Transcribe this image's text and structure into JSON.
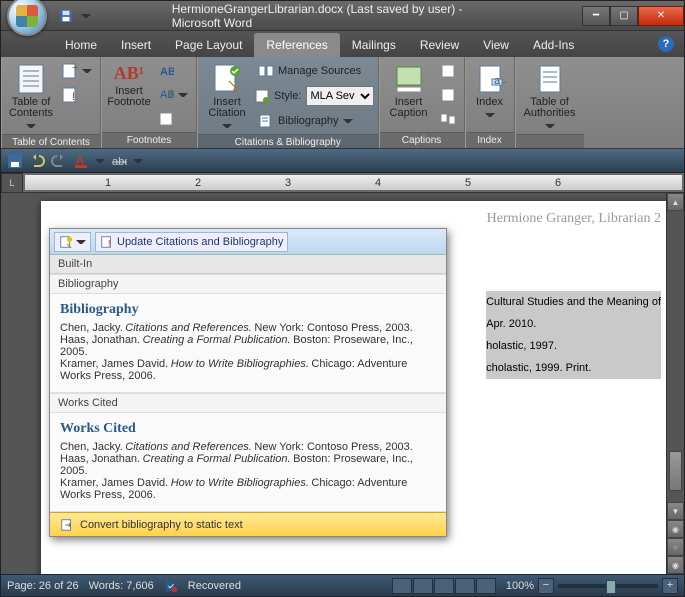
{
  "title": "HermioneGrangerLibrarian.docx (Last saved by user) - Microsoft Word",
  "tabs": [
    "Home",
    "Insert",
    "Page Layout",
    "References",
    "Mailings",
    "Review",
    "View",
    "Add-Ins"
  ],
  "activeTab": "References",
  "ribbon": {
    "toc": {
      "btn": "Table of\nContents",
      "label": "Table of Contents"
    },
    "footnotes": {
      "btn": "Insert\nFootnote",
      "ab": "AB¹",
      "label": "Footnotes"
    },
    "citations": {
      "btn": "Insert\nCitation",
      "manage": "Manage Sources",
      "styleLabel": "Style:",
      "styleVal": "MLA Sev",
      "bib": "Bibliography",
      "label": "Citations & Bibliography"
    },
    "captions": {
      "btn": "Insert\nCaption",
      "label": "Captions"
    },
    "index": {
      "btn": "Index",
      "label": "Index"
    },
    "toa": {
      "btn": "Table of\nAuthorities",
      "label": ""
    }
  },
  "gallery": {
    "update": "Update Citations and Bibliography",
    "builtin": "Built-In",
    "items": [
      {
        "sub": "Bibliography",
        "title": "Bibliography",
        "refs": [
          {
            "a": "Chen, Jacky.",
            "t": "Citations and References.",
            "p": "New York: Contoso Press, 2003."
          },
          {
            "a": "Haas, Jonathan.",
            "t": "Creating a Formal Publication.",
            "p": "Boston: Proseware, Inc., 2005."
          },
          {
            "a": "Kramer, James David.",
            "t": "How to Write Bibliographies.",
            "p": "Chicago: Adventure Works Press, 2006."
          }
        ]
      },
      {
        "sub": "Works Cited",
        "title": "Works Cited",
        "refs": [
          {
            "a": "Chen, Jacky.",
            "t": "Citations and References.",
            "p": "New York: Contoso Press, 2003."
          },
          {
            "a": "Haas, Jonathan.",
            "t": "Creating a Formal Publication.",
            "p": "Boston: Proseware, Inc., 2005."
          },
          {
            "a": "Kramer, James David.",
            "t": "How to Write Bibliographies.",
            "p": "Chicago: Adventure Works Press, 2006."
          }
        ]
      }
    ],
    "convert": "Convert bibliography to static text"
  },
  "ruler": [
    "1",
    "2",
    "3",
    "4",
    "5",
    "6"
  ],
  "page": {
    "header": "Hermione Granger, Librarian  2",
    "lines": [
      "Cultural Studies and the Meaning of",
      " Apr. 2010.",
      "holastic, 1997.",
      "cholastic, 1999. Print."
    ]
  },
  "status": {
    "page": "Page: 26 of 26",
    "words": "Words: 7,606",
    "recovered": "Recovered",
    "zoom": "100%"
  }
}
